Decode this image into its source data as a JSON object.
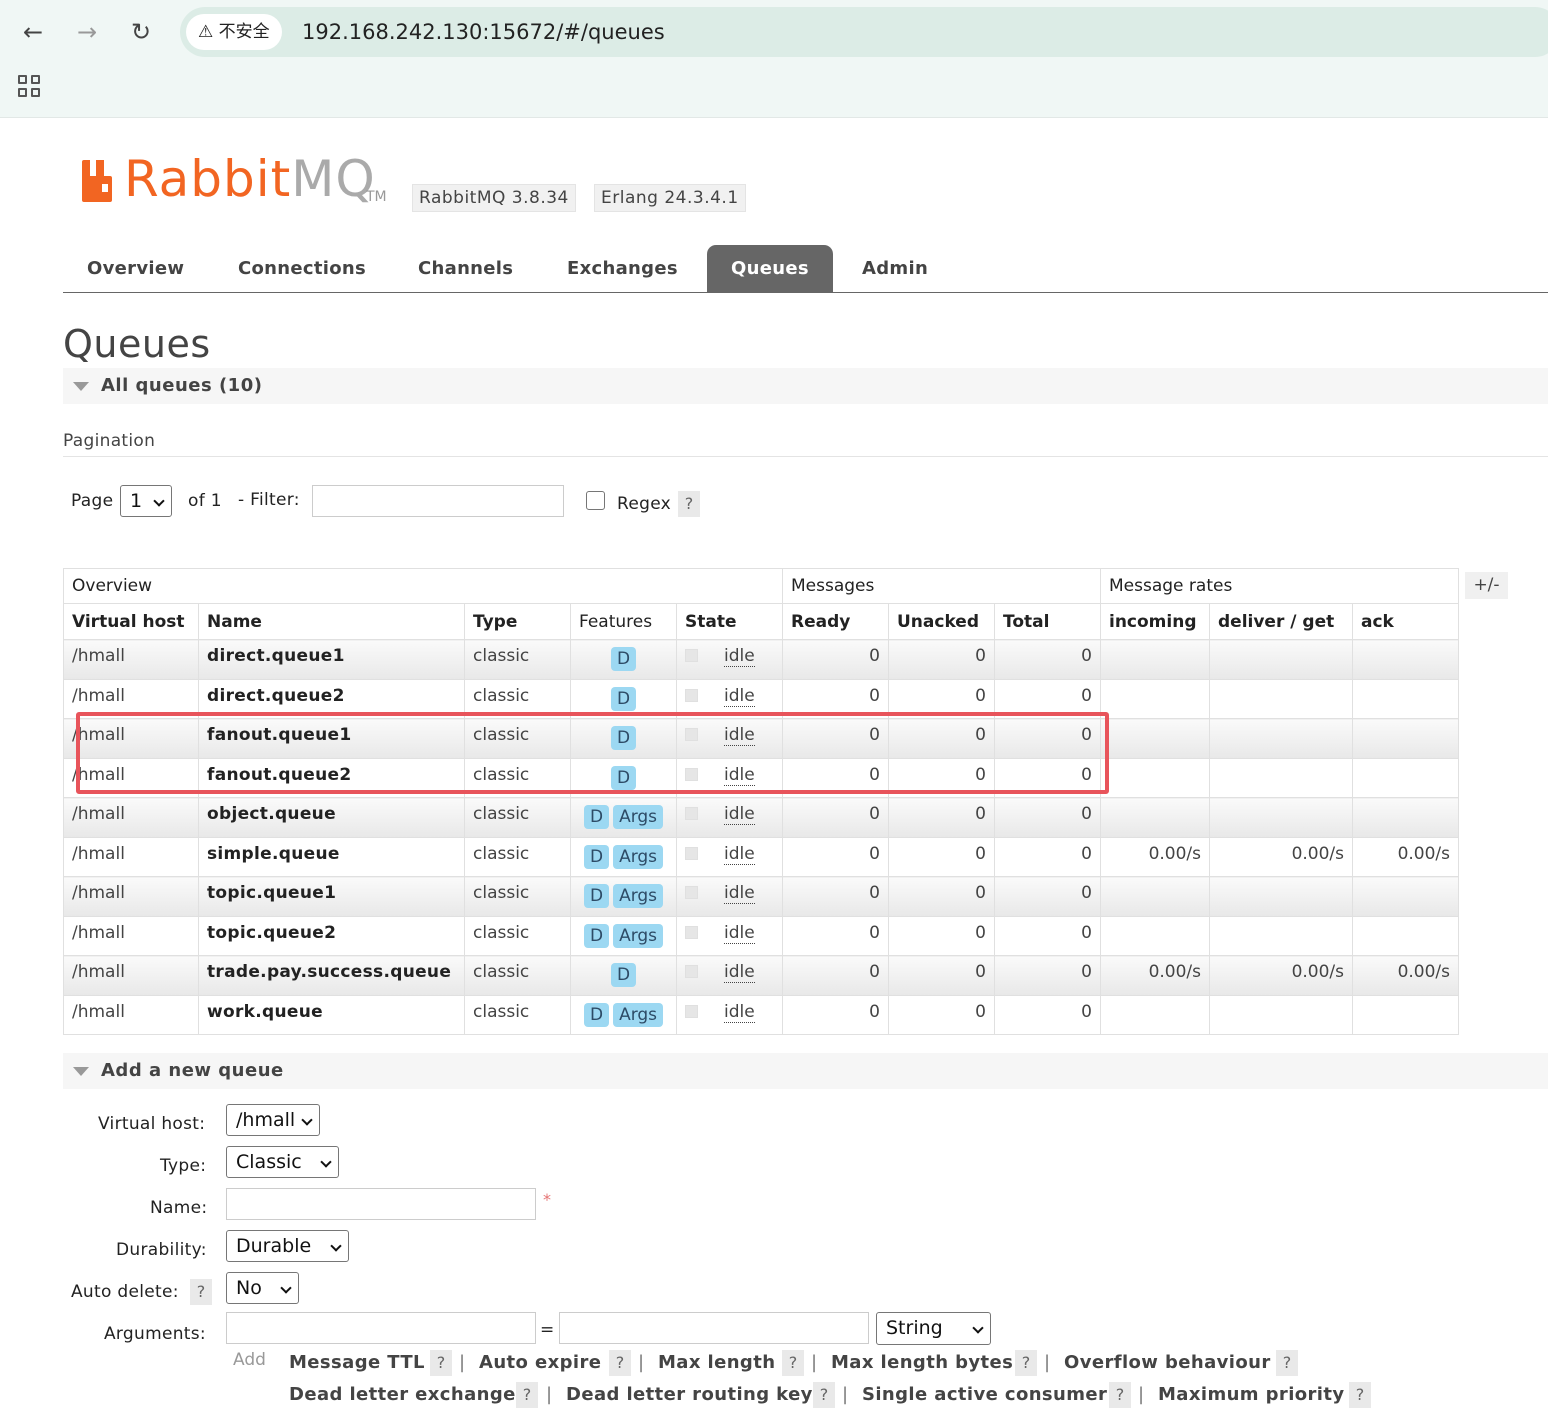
{
  "browser": {
    "security_label": "不安全",
    "url": "192.168.242.130:15672/#/queues"
  },
  "header": {
    "logo_brand": "Rabbit",
    "logo_suffix": "MQ",
    "logo_tm": "TM",
    "rabbitmq_version": "RabbitMQ 3.8.34",
    "erlang_version": "Erlang 24.3.4.1"
  },
  "tabs": [
    "Overview",
    "Connections",
    "Channels",
    "Exchanges",
    "Queues",
    "Admin"
  ],
  "active_tab": "Queues",
  "page_title": "Queues",
  "all_queues_label": "All queues (10)",
  "pagination": {
    "section_label": "Pagination",
    "page_label": "Page",
    "page_value": "1",
    "of_label": "of 1",
    "filter_label": "- Filter:",
    "filter_value": "",
    "regex_label": "Regex",
    "help": "?"
  },
  "table": {
    "group_headers": [
      "Overview",
      "Messages",
      "Message rates"
    ],
    "columns": [
      "Virtual host",
      "Name",
      "Type",
      "Features",
      "State",
      "Ready",
      "Unacked",
      "Total",
      "incoming",
      "deliver / get",
      "ack"
    ],
    "toggle_label": "+/-",
    "rows": [
      {
        "vhost": "/hmall",
        "name": "direct.queue1",
        "type": "classic",
        "features": [
          "D"
        ],
        "state": "idle",
        "ready": "0",
        "unacked": "0",
        "total": "0",
        "incoming": "",
        "deliver_get": "",
        "ack": ""
      },
      {
        "vhost": "/hmall",
        "name": "direct.queue2",
        "type": "classic",
        "features": [
          "D"
        ],
        "state": "idle",
        "ready": "0",
        "unacked": "0",
        "total": "0",
        "incoming": "",
        "deliver_get": "",
        "ack": ""
      },
      {
        "vhost": "/hmall",
        "name": "fanout.queue1",
        "type": "classic",
        "features": [
          "D"
        ],
        "state": "idle",
        "ready": "0",
        "unacked": "0",
        "total": "0",
        "incoming": "",
        "deliver_get": "",
        "ack": ""
      },
      {
        "vhost": "/hmall",
        "name": "fanout.queue2",
        "type": "classic",
        "features": [
          "D"
        ],
        "state": "idle",
        "ready": "0",
        "unacked": "0",
        "total": "0",
        "incoming": "",
        "deliver_get": "",
        "ack": ""
      },
      {
        "vhost": "/hmall",
        "name": "object.queue",
        "type": "classic",
        "features": [
          "D",
          "Args"
        ],
        "state": "idle",
        "ready": "0",
        "unacked": "0",
        "total": "0",
        "incoming": "",
        "deliver_get": "",
        "ack": ""
      },
      {
        "vhost": "/hmall",
        "name": "simple.queue",
        "type": "classic",
        "features": [
          "D",
          "Args"
        ],
        "state": "idle",
        "ready": "0",
        "unacked": "0",
        "total": "0",
        "incoming": "0.00/s",
        "deliver_get": "0.00/s",
        "ack": "0.00/s"
      },
      {
        "vhost": "/hmall",
        "name": "topic.queue1",
        "type": "classic",
        "features": [
          "D",
          "Args"
        ],
        "state": "idle",
        "ready": "0",
        "unacked": "0",
        "total": "0",
        "incoming": "",
        "deliver_get": "",
        "ack": ""
      },
      {
        "vhost": "/hmall",
        "name": "topic.queue2",
        "type": "classic",
        "features": [
          "D",
          "Args"
        ],
        "state": "idle",
        "ready": "0",
        "unacked": "0",
        "total": "0",
        "incoming": "",
        "deliver_get": "",
        "ack": ""
      },
      {
        "vhost": "/hmall",
        "name": "trade.pay.success.queue",
        "type": "classic",
        "features": [
          "D"
        ],
        "state": "idle",
        "ready": "0",
        "unacked": "0",
        "total": "0",
        "incoming": "0.00/s",
        "deliver_get": "0.00/s",
        "ack": "0.00/s"
      },
      {
        "vhost": "/hmall",
        "name": "work.queue",
        "type": "classic",
        "features": [
          "D",
          "Args"
        ],
        "state": "idle",
        "ready": "0",
        "unacked": "0",
        "total": "0",
        "incoming": "",
        "deliver_get": "",
        "ack": ""
      }
    ]
  },
  "add_queue": {
    "section_label": "Add a new queue",
    "vhost_label": "Virtual host:",
    "vhost_value": "/hmall",
    "type_label": "Type:",
    "type_value": "Classic",
    "name_label": "Name:",
    "name_value": "",
    "required_mark": "*",
    "durability_label": "Durability:",
    "durability_value": "Durable",
    "auto_delete_label": "Auto delete:",
    "auto_delete_value": "No",
    "arguments_label": "Arguments:",
    "equals": "=",
    "arg_type_value": "String",
    "add_label": "Add",
    "help": "?",
    "separator": "|",
    "arg_links": [
      "Message TTL",
      "Auto expire",
      "Max length",
      "Max length bytes",
      "Overflow behaviour",
      "Dead letter exchange",
      "Dead letter routing key",
      "Single active consumer",
      "Maximum priority"
    ]
  },
  "colors": {
    "brand_orange": "#f26522",
    "active_tab_bg": "#666666",
    "badge_bg": "#9cd8f2",
    "highlight_border": "#e8545b"
  }
}
